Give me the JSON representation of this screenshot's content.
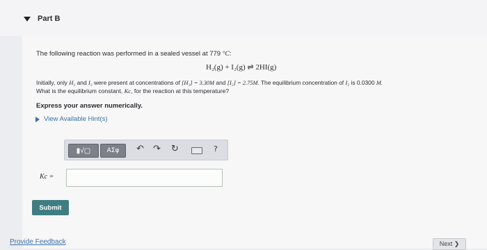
{
  "part": {
    "title": "Part B"
  },
  "problem": {
    "intro_prefix": "The following reaction was performed in a sealed vessel at 779 ",
    "intro_unit": "°C",
    "intro_suffix": ":",
    "equation": "H₂(g) + I₂(g) ⇌ 2HI(g)",
    "line1_a": "Initially, only ",
    "line1_b": "H₂",
    "line1_c": " and ",
    "line1_d": "I₂",
    "line1_e": " were present at concentrations of ",
    "line1_f": "[H₂] = 3.30M",
    "line1_g": " and ",
    "line1_h": "[I₂] = 2.75M",
    "line1_i": ". The equilibrium concentration of ",
    "line1_j": "I₂",
    "line1_k": " is 0.0300 ",
    "line1_l": "M",
    "line1_m": ".",
    "line2_a": "What is the equilibrium constant, ",
    "line2_b": "Kc",
    "line2_c": ", for the reaction at this temperature?",
    "express": "Express your answer numerically."
  },
  "hints": {
    "label": "View Available Hint(s)"
  },
  "toolbar": {
    "template_button": "▮√▢",
    "greek_button": "ΑΣφ",
    "undo_icon": "↶",
    "redo_icon": "↷",
    "reset_icon": "↻",
    "help_icon": "?"
  },
  "answer": {
    "label": "Kc =",
    "value": ""
  },
  "actions": {
    "submit": "Submit",
    "feedback": "Provide Feedback",
    "next": "Next ❯"
  }
}
